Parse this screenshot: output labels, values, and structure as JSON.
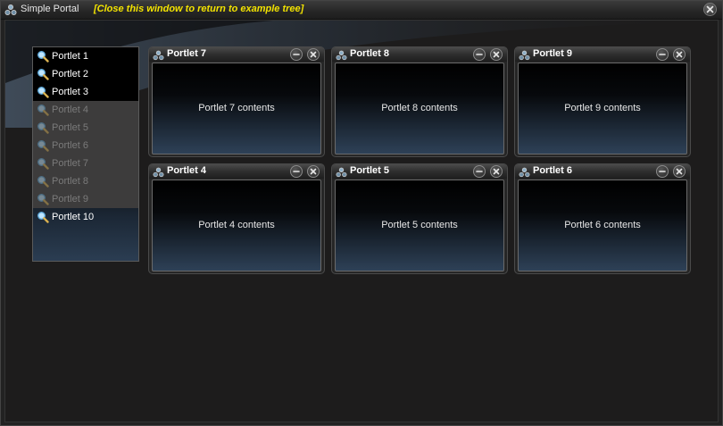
{
  "window": {
    "title": "Simple Portal",
    "subtitle": "[Close this window to return to example tree]",
    "close_icon": "close-icon",
    "app_icon": "portlet-icon"
  },
  "sidebar": {
    "items": [
      {
        "label": "Portlet 1",
        "enabled": true
      },
      {
        "label": "Portlet 2",
        "enabled": true
      },
      {
        "label": "Portlet 3",
        "enabled": true
      },
      {
        "label": "Portlet 4",
        "enabled": false
      },
      {
        "label": "Portlet 5",
        "enabled": false
      },
      {
        "label": "Portlet 6",
        "enabled": false
      },
      {
        "label": "Portlet 7",
        "enabled": false
      },
      {
        "label": "Portlet 8",
        "enabled": false
      },
      {
        "label": "Portlet 9",
        "enabled": false
      },
      {
        "label": "Portlet 10",
        "enabled": true
      }
    ],
    "item_icon": "magnifier-icon"
  },
  "portlets": [
    {
      "title": "Portlet 7",
      "contents": "Portlet 7 contents"
    },
    {
      "title": "Portlet 8",
      "contents": "Portlet 8 contents"
    },
    {
      "title": "Portlet 9",
      "contents": "Portlet 9 contents"
    },
    {
      "title": "Portlet 4",
      "contents": "Portlet 4 contents"
    },
    {
      "title": "Portlet 5",
      "contents": "Portlet 5 contents"
    },
    {
      "title": "Portlet 6",
      "contents": "Portlet 6 contents"
    }
  ],
  "colors": {
    "subtitle": "#f3e300",
    "background": "#1d1c1c",
    "disabled_item": "#3d3c3c",
    "disabled_text": "#7a7a7a"
  }
}
